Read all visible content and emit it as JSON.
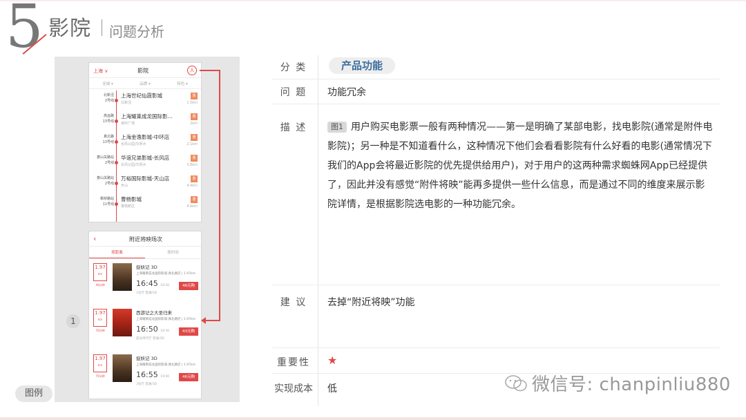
{
  "header": {
    "number": "5",
    "title": "影院",
    "subtitle": "问题分析"
  },
  "mockup": {
    "marker": "1",
    "example_label": "图例",
    "phone1": {
      "city": "上海 ∨",
      "title": "影院",
      "avatar": "人",
      "filters": [
        "全城 ▾",
        "品牌 ▾",
        "特色 ▾"
      ],
      "cinemas": [
        {
          "dist": "北新泾",
          "line": "2号线",
          "name": "上海世纪仙霞影城",
          "addr": "北新泾",
          "km": "1.5km",
          "tag": "惠"
        },
        {
          "dist": "高运路",
          "line": "13号线",
          "name": "上海耀莱成龙国际影...",
          "addr": "城中广场",
          "km": "2km",
          "tag": "惠"
        },
        {
          "dist": "真北路",
          "line": "13号线",
          "name": "上海金逸影城-中环店",
          "addr": "长风公园/华师大",
          "km": "2.1km",
          "tag": "惠"
        },
        {
          "dist": "娄山关路站",
          "line": "2号线",
          "name": "华谊兄弟影城-长风店",
          "addr": "长风公园/华师大",
          "km": "3.8km",
          "tag": "惠"
        },
        {
          "dist": "娄山关路站",
          "line": "2号线",
          "name": "万裕国际影城-天山店",
          "addr": "天山",
          "km": "4.4km",
          "tag": "惠"
        },
        {
          "dist": "枫桥路站",
          "line": "11号线",
          "name": "曹杨影城",
          "addr": "曹杨新区",
          "km": "4.6km",
          "tag": "惠"
        }
      ]
    },
    "phone2": {
      "back": "‹",
      "title": "附近将映场次",
      "tabs": [
        "按距离",
        "按时间"
      ],
      "cards": [
        {
          "date": "1.97",
          "unit": "km",
          "mins": "40分钟",
          "movie": "捉妖记 3D",
          "cinema": "上海耀莱成龙国际影城-真北路店 | 1.97km",
          "time": "16:45",
          "end": "18:50",
          "hall": "1号厅   普通/3D",
          "price": "46元购",
          "poster": "red"
        },
        {
          "date": "1.97",
          "unit": "km",
          "mins": "70分钟",
          "movie": "西游记之大圣归来",
          "cinema": "上海耀莱成龙国际影城-真北路店 | 1.97km",
          "time": "16:50",
          "end": "18:30",
          "hall": "成龙单行厅   普通/3D",
          "price": "43元购",
          "poster": "alt"
        },
        {
          "date": "1.97",
          "unit": "km",
          "mins": "75分钟",
          "movie": "捉妖记 3D",
          "cinema": "上海耀莱成龙国际影城-真北路店 | 1.97km",
          "time": "16:55",
          "end": "19:00",
          "hall": "3号厅   普通/3D",
          "price": "46元购",
          "poster": "red"
        }
      ]
    }
  },
  "table": {
    "category_label": "分 类",
    "category_value": "产品功能",
    "problem_label": "问 题",
    "problem_value": "功能冗余",
    "desc_label": "描 述",
    "desc_tag": "图1",
    "desc_value": "用户购买电影票一般有两种情况——第一是明确了某部电影，找电影院(通常是附件电影院)；另一种是不知道看什么，这种情况下他们会看看影院有什么好看的电影(通常情况下我们的App会将最近影院的优先提供给用户)，对于用户的这两种需求蜘蛛网App已经提供了，因此并没有感觉“附件将映”能再多提供一些什么信息，而是通过不同的维度来展示影院详情，是根据影院选电影的一种功能冗余。",
    "suggest_label": "建 议",
    "suggest_value": "去掉“附近将映”功能",
    "importance_label": "重要性",
    "importance_value": "★",
    "cost_label": "实现成本",
    "cost_value": "低"
  },
  "watermark": "微信号: chanpinliu880",
  "colors": {
    "accent": "#e04848",
    "category_text": "#3a6e9e"
  }
}
